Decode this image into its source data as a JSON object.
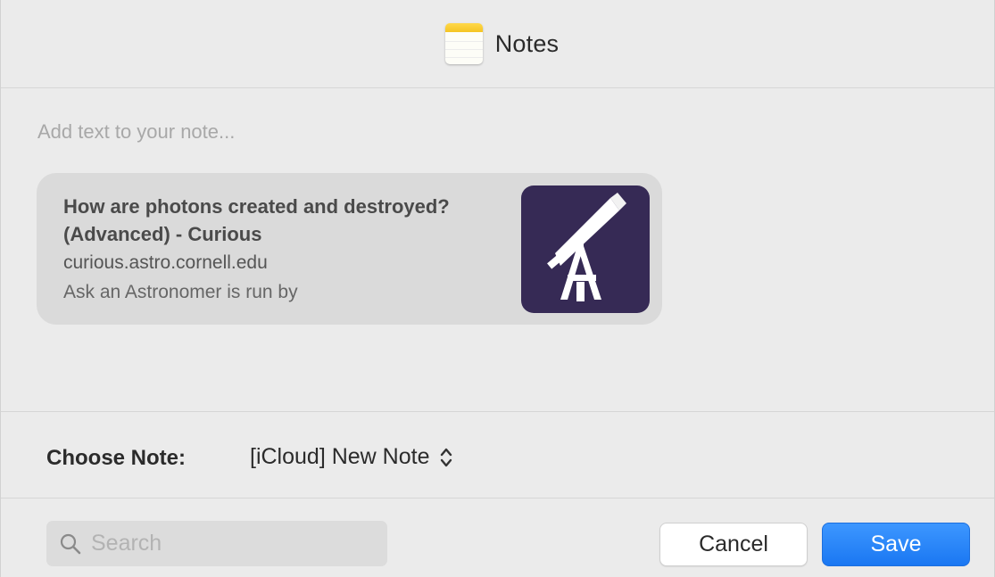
{
  "window": {
    "title": "Notes",
    "icon": "notes-app-icon"
  },
  "note": {
    "placeholder": "Add text to your note..."
  },
  "link_card": {
    "title": "How are photons created and destroyed? (Advanced) - Curious",
    "url": "curious.astro.cornell.edu",
    "excerpt": "Ask an Astronomer is run by",
    "thumbnail_icon": "telescope-icon",
    "thumbnail_color": "#362a55"
  },
  "choose_note": {
    "label": "Choose Note:",
    "selected": "[iCloud] New Note"
  },
  "search": {
    "placeholder": "Search",
    "value": ""
  },
  "buttons": {
    "cancel": "Cancel",
    "save": "Save"
  },
  "colors": {
    "accent": "#1a77f2",
    "notes_yellow": "#f5c423"
  }
}
